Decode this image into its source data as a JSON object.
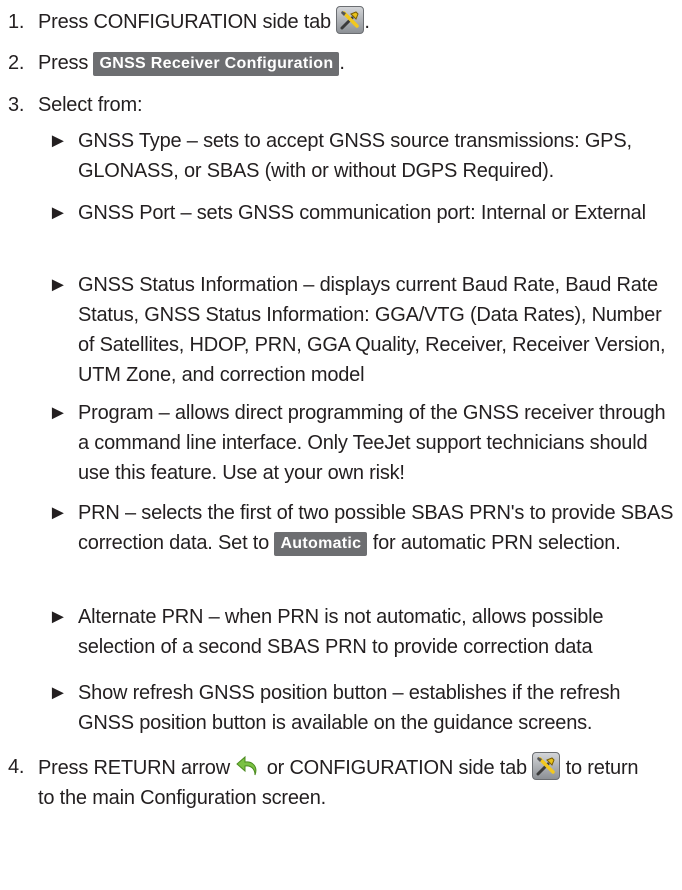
{
  "steps": [
    {
      "num": "1.",
      "text_before": "Press CONFIGURATION side tab",
      "text_after": "."
    },
    {
      "num": "2.",
      "text_before": "Press",
      "button": "GNSS Receiver Configuration",
      "text_after": "."
    },
    {
      "num": "3.",
      "text": "Select from:"
    },
    {
      "num": "4.",
      "text_a": "Press RETURN arrow",
      "text_b": "or CONFIGURATION side tab",
      "text_c": "to return to the main Configuration screen."
    }
  ],
  "bullet_glyph": "►",
  "options": [
    {
      "text": "GNSS Type – sets to accept GNSS source transmissions: GPS, GLONASS, or SBAS (with or without DGPS Required)."
    },
    {
      "text": "GNSS Port – sets GNSS communication port: Internal or External"
    },
    {
      "text": "GNSS Status Information – displays current Baud Rate, Baud Rate Status, GNSS Status Information: GGA/VTG (Data Rates), Number of Satellites, HDOP, PRN, GGA Quality, Receiver, Receiver Version, UTM Zone, and correction model"
    },
    {
      "text": "Program – allows direct programming of the GNSS receiver through a command line interface. Only TeeJet support technicians should use this feature. Use at your own risk!"
    },
    {
      "text_before": "PRN – selects the first of two possible SBAS PRN's to provide SBAS correction data. Set to",
      "button": "Automatic",
      "text_after": "for automatic PRN selection."
    },
    {
      "text": "Alternate PRN – when PRN is not automatic, allows possible selection of a second SBAS PRN to provide correction data"
    },
    {
      "text": "Show refresh GNSS position button – establishes if the refresh GNSS position button is available on the guidance screens."
    }
  ],
  "icons": {
    "configuration_tab": "tools-icon",
    "return_arrow": "return-arrow-icon"
  },
  "colors": {
    "text": "#231f20",
    "button_bg": "#6d6e71",
    "button_text": "#ffffff",
    "arrow_green": "#7ac143"
  }
}
